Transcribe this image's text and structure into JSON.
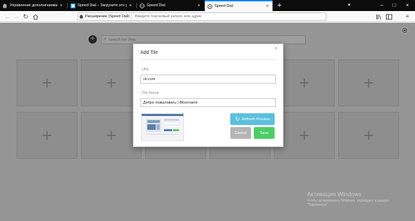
{
  "tabs": [
    {
      "title": "Управление дополнениями",
      "icon": "addons-puzzle-icon",
      "active": false
    },
    {
      "title": "Speed Dial – Загрузите это ра",
      "icon": "speed-dial-icon",
      "active": false
    },
    {
      "title": "Speed Dial",
      "icon": "globe-icon",
      "active": false
    },
    {
      "title": "Speed Dial",
      "icon": "speed-dial-icon",
      "active": true
    }
  ],
  "new_tab_label": "+",
  "navbar": {
    "identity_label": "Расширение (Speed Dial)",
    "address_placeholder": "Введите поисковый запрос или адрес"
  },
  "speed_dial": {
    "search_placeholder": "Search the Web",
    "add_button_label": "+",
    "tile_plus": "+"
  },
  "modal": {
    "title": "Add Tile",
    "close_label": "×",
    "url_label": "URL",
    "url_value": "vk.com",
    "tile_name_label": "Tile Name",
    "tile_name_value": "Добро пожаловать | ВКонтакте",
    "refresh_label": "Refresh Preview",
    "cancel_label": "Cancel",
    "save_label": "Save"
  },
  "watermark": {
    "title": "Активация Windows",
    "subtitle": "Чтобы активировать Windows, перейдите в раздел \"Параметры\"."
  },
  "colors": {
    "accent_blue": "#0a84ff",
    "refresh_button": "#5bc0de",
    "save_button": "#4cce67",
    "cancel_button": "#b5b5b5"
  }
}
